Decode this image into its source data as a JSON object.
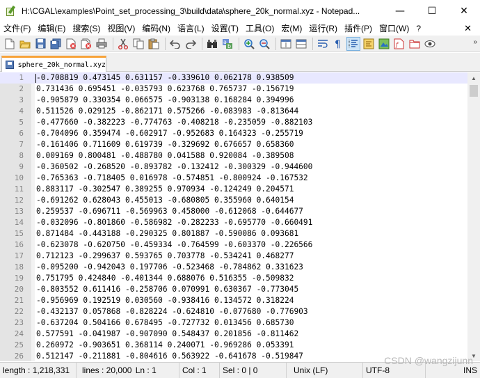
{
  "window": {
    "title": "H:\\CGAL\\examples\\Point_set_processing_3\\build\\data\\sphere_20k_normal.xyz - Notepad...",
    "minimize": "—",
    "maximize": "☐",
    "close": "✕"
  },
  "menu": {
    "items": [
      "文件(F)",
      "编辑(E)",
      "搜索(S)",
      "视图(V)",
      "编码(N)",
      "语言(L)",
      "设置(T)",
      "工具(O)",
      "宏(M)",
      "运行(R)",
      "插件(P)",
      "窗口(W)",
      "?"
    ],
    "close": "✕"
  },
  "toolbar": {
    "icons": [
      "new-file-icon",
      "open-file-icon",
      "save-icon",
      "save-all-icon",
      "close-icon",
      "close-all-icon",
      "print-icon",
      "cut-icon",
      "copy-icon",
      "paste-icon",
      "undo-icon",
      "redo-icon",
      "find-icon",
      "replace-icon",
      "zoom-in-icon",
      "zoom-out-icon",
      "sync-vertical-icon",
      "sync-horizontal-icon",
      "word-wrap-icon",
      "show-all-chars-icon",
      "indent-guide-icon",
      "language-icon",
      "doc-map-icon",
      "function-list-icon",
      "folder-workspace-icon",
      "monitor-icon"
    ]
  },
  "tab": {
    "label": "sphere_20k_normal.xyz"
  },
  "editor": {
    "lines": [
      {
        "n": "1",
        "text": "-0.708819 0.473145 0.631157 -0.339610 0.062178 0.938509"
      },
      {
        "n": "2",
        "text": "0.731436 0.695451 -0.035793 0.623768 0.765737 -0.156719"
      },
      {
        "n": "3",
        "text": "-0.905879 0.330354 0.066575 -0.903138 0.168284 0.394996"
      },
      {
        "n": "4",
        "text": "0.511526 0.029125 -0.862171 0.575266 -0.083983 -0.813644"
      },
      {
        "n": "5",
        "text": "-0.477660 -0.382223 -0.774763 -0.408218 -0.235059 -0.882103"
      },
      {
        "n": "6",
        "text": "-0.704096 0.359474 -0.602917 -0.952683 0.164323 -0.255719"
      },
      {
        "n": "7",
        "text": "-0.161406 0.711609 0.619739 -0.329692 0.676657 0.658360"
      },
      {
        "n": "8",
        "text": "0.009169 0.800481 -0.488780 0.041588 0.920084 -0.389508"
      },
      {
        "n": "9",
        "text": "-0.360502 -0.268520 -0.893782 -0.132412 -0.300329 -0.944600"
      },
      {
        "n": "10",
        "text": "-0.765363 -0.718405 0.016978 -0.574851 -0.800924 -0.167532"
      },
      {
        "n": "11",
        "text": "0.883117 -0.302547 0.389255 0.970934 -0.124249 0.204571"
      },
      {
        "n": "12",
        "text": "-0.691262 0.628043 0.455013 -0.680805 0.355960 0.640154"
      },
      {
        "n": "13",
        "text": "0.259537 -0.696711 -0.569963 0.458000 -0.612068 -0.644677"
      },
      {
        "n": "14",
        "text": "-0.032096 -0.801860 -0.586982 -0.282233 -0.695770 -0.660491"
      },
      {
        "n": "15",
        "text": "0.871484 -0.443188 -0.290325 0.801887 -0.590086 0.093681"
      },
      {
        "n": "16",
        "text": "-0.623078 -0.620750 -0.459334 -0.764599 -0.603370 -0.226566"
      },
      {
        "n": "17",
        "text": "0.712123 -0.299637 0.593765 0.703778 -0.534241 0.468277"
      },
      {
        "n": "18",
        "text": "-0.095200 -0.942043 0.197706 -0.523468 -0.784862 0.331623"
      },
      {
        "n": "19",
        "text": "0.751795 0.424840 -0.401344 0.688076 0.516355 -0.509832"
      },
      {
        "n": "20",
        "text": "-0.803552 0.611416 -0.258706 0.070991 0.630367 -0.773045"
      },
      {
        "n": "21",
        "text": "-0.956969 0.192519 0.030560 -0.938416 0.134572 0.318224"
      },
      {
        "n": "22",
        "text": "-0.432137 0.057868 -0.828224 -0.624810 -0.077680 -0.776903"
      },
      {
        "n": "23",
        "text": "-0.637204 0.504166 0.678495 -0.727732 0.013456 0.685730"
      },
      {
        "n": "24",
        "text": "0.577591 -0.041987 -0.907090 0.548437 0.201856 -0.811462"
      },
      {
        "n": "25",
        "text": "0.260972 -0.903651 0.368114 0.240071 -0.969286 0.053391"
      },
      {
        "n": "26",
        "text": "0.512147 -0.211881 -0.804616 0.563922 -0.641678 -0.519847"
      }
    ]
  },
  "statusbar": {
    "length": "length : 1,218,331",
    "lines": "lines : 20,000",
    "ln": "Ln : 1",
    "col": "Col : 1",
    "sel": "Sel : 0 | 0",
    "eol": "Unix (LF)",
    "encoding": "UTF-8",
    "mode": "INS"
  },
  "watermark": "CSDN @wangzijunn"
}
